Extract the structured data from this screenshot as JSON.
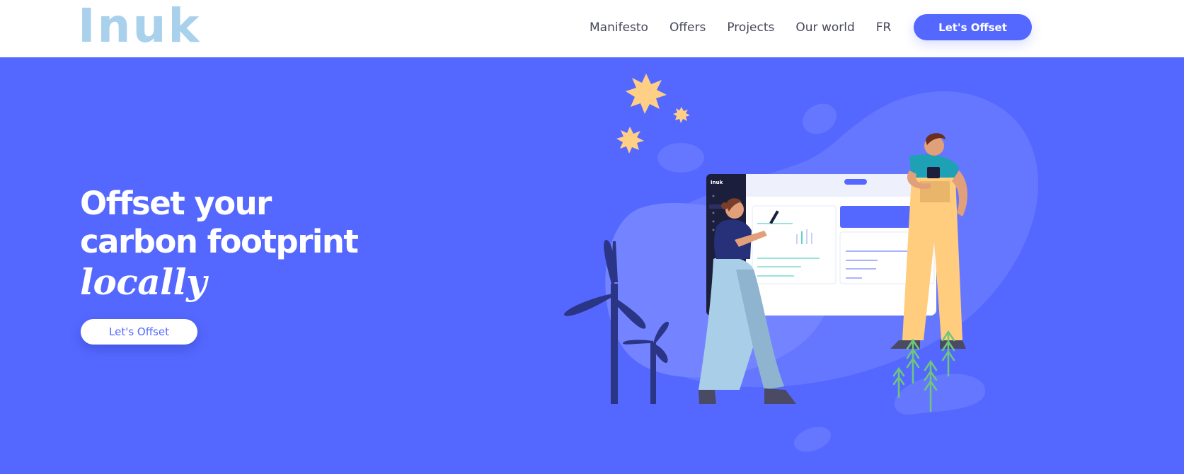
{
  "header": {
    "logo": "Inuk",
    "nav": [
      "Manifesto",
      "Offers",
      "Projects",
      "Our world",
      "FR"
    ],
    "cta_label": "Let's Offset"
  },
  "hero": {
    "title_line1": "Offset your",
    "title_line2": "carbon footprint",
    "title_line3": "locally",
    "cta_label": "Let's Offset",
    "dashboard_logo": "Inuk"
  },
  "colors": {
    "brand": "#5468ff",
    "logo": "#a9d1ec",
    "star": "#ffcf86",
    "turbine": "#2a3585",
    "tree": "#6cc77b"
  }
}
